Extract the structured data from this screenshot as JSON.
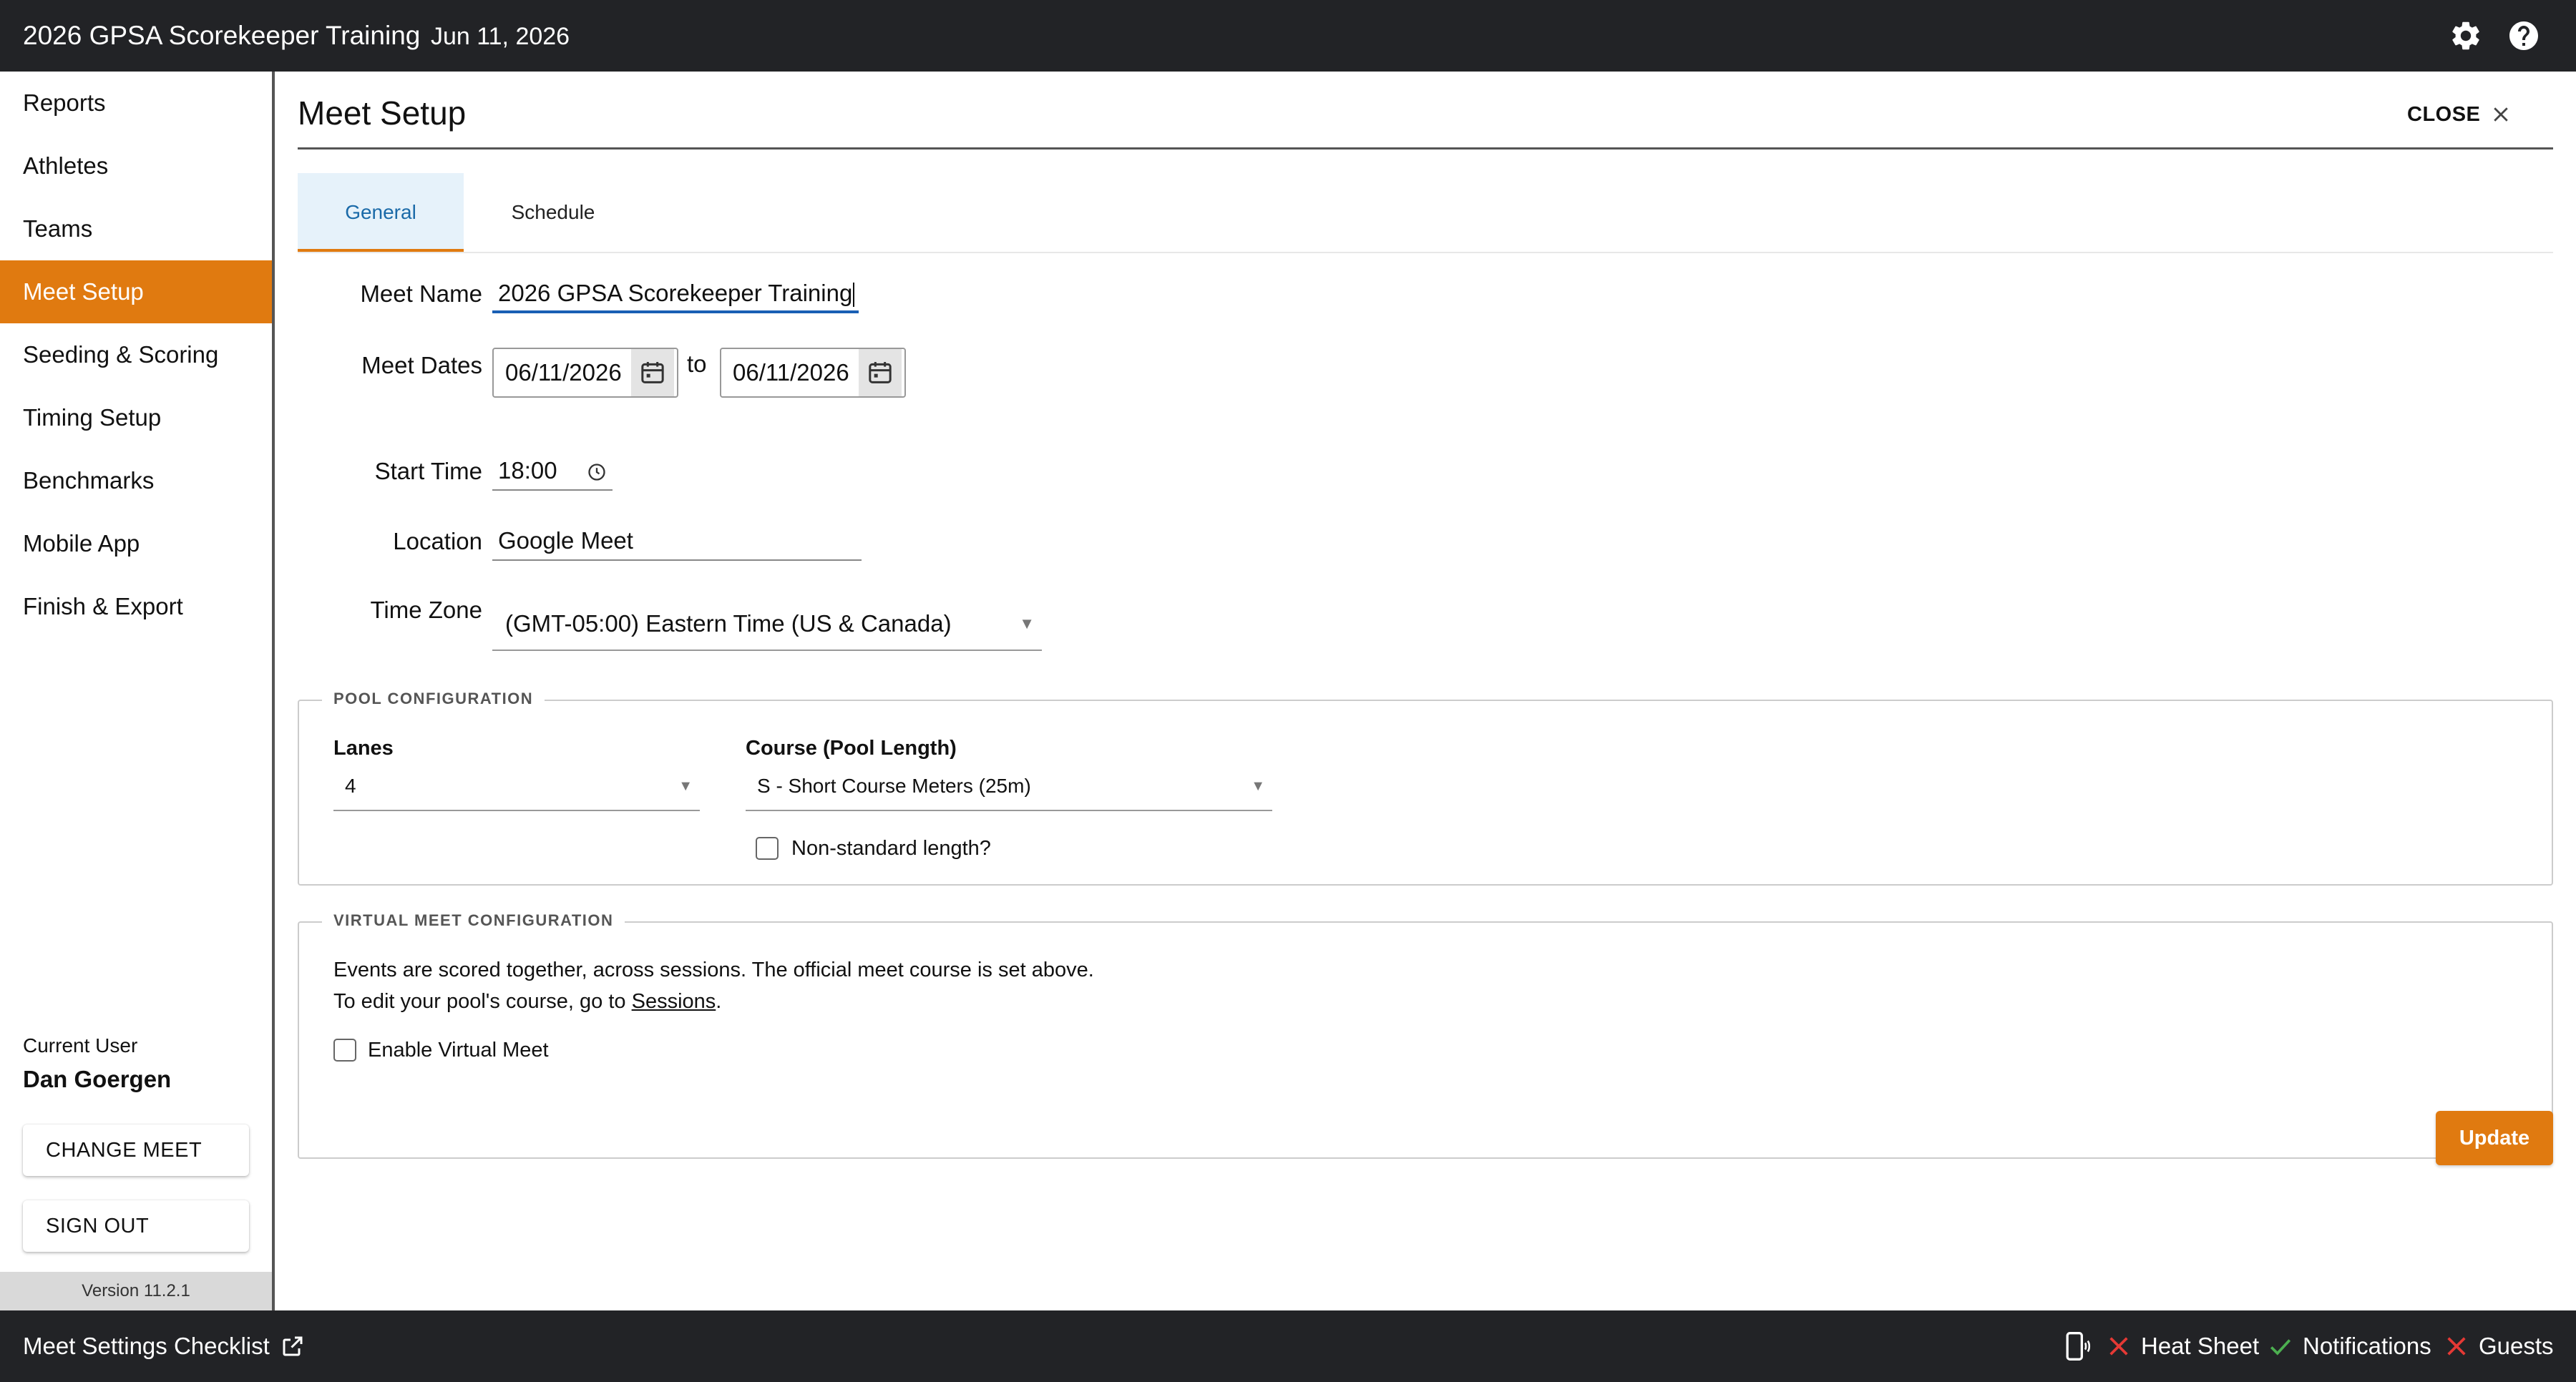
{
  "header": {
    "app_title": "2026 GPSA Scorekeeper Training",
    "date": "Jun 11, 2026",
    "settings_icon": "gear-icon",
    "help_icon": "help-circle-icon"
  },
  "sidebar": {
    "items": [
      {
        "label": "Reports"
      },
      {
        "label": "Athletes"
      },
      {
        "label": "Teams"
      },
      {
        "label": "Meet Setup",
        "active": true
      },
      {
        "label": "Seeding & Scoring"
      },
      {
        "label": "Timing Setup"
      },
      {
        "label": "Benchmarks"
      },
      {
        "label": "Mobile App"
      },
      {
        "label": "Finish & Export"
      }
    ],
    "current_user_label": "Current User",
    "current_user_name": "Dan Goergen",
    "change_meet_label": "CHANGE MEET",
    "sign_out_label": "SIGN OUT",
    "version": "Version 11.2.1"
  },
  "main": {
    "title": "Meet Setup",
    "close_label": "CLOSE",
    "tabs": [
      {
        "label": "General",
        "active": true
      },
      {
        "label": "Schedule"
      }
    ],
    "form": {
      "meet_name_label": "Meet Name",
      "meet_name_value": "2026 GPSA Scorekeeper Training",
      "meet_dates_label": "Meet Dates",
      "start_date": "06/11/2026",
      "to_label": "to",
      "end_date": "06/11/2026",
      "start_time_label": "Start Time",
      "start_time_value": "18:00",
      "location_label": "Location",
      "location_value": "Google Meet",
      "time_zone_label": "Time Zone",
      "time_zone_value": "(GMT-05:00) Eastern Time (US & Canada)"
    },
    "pool_config": {
      "legend": "POOL CONFIGURATION",
      "lanes_label": "Lanes",
      "lanes_value": "4",
      "course_label": "Course (Pool Length)",
      "course_value": "S - Short Course Meters (25m)",
      "nonstandard_label": "Non-standard length?",
      "nonstandard_checked": false
    },
    "virtual_config": {
      "legend": "VIRTUAL MEET CONFIGURATION",
      "line1": "Events are scored together, across sessions. The official meet course is set above.",
      "line2_prefix": "To edit your pool's course, go to ",
      "line2_link": "Sessions",
      "line2_suffix": ".",
      "enable_label": "Enable Virtual Meet",
      "enable_checked": false
    },
    "update_label": "Update"
  },
  "footer": {
    "checklist_label": "Meet Settings Checklist",
    "device_icon": "mobile-device-icon",
    "statuses": [
      {
        "label": "Heat Sheet",
        "ok": false
      },
      {
        "label": "Notifications",
        "ok": true
      },
      {
        "label": "Guests",
        "ok": false
      }
    ],
    "colors": {
      "ok": "#4caf50",
      "fail": "#e53935"
    }
  },
  "colors": {
    "accent": "#e07a10",
    "bar": "#222326",
    "tab_active_bg": "#e6f2fa",
    "tab_active_text": "#1a6aa8"
  }
}
